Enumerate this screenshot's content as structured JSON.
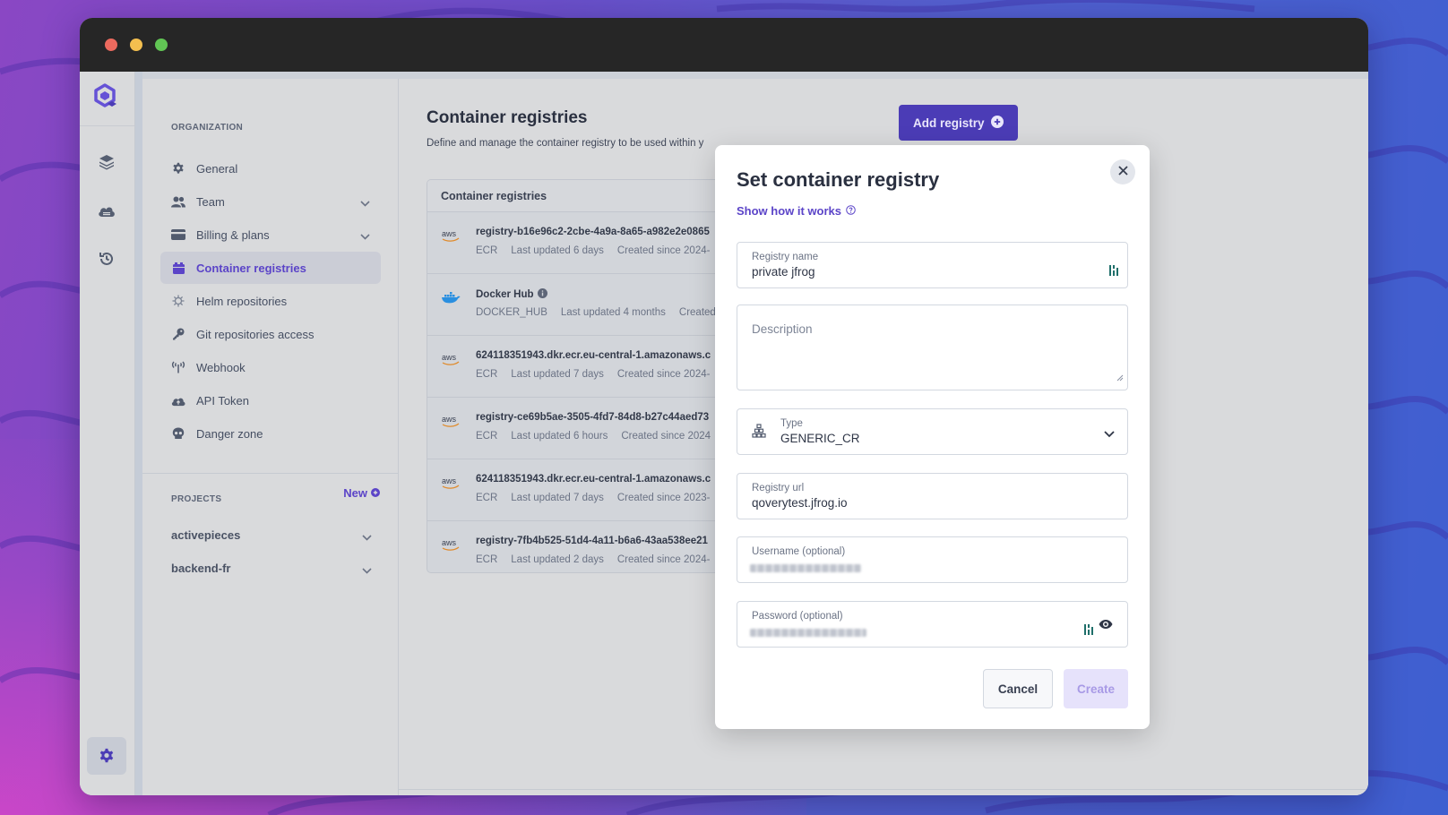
{
  "window": {
    "controls": [
      "close",
      "minimize",
      "maximize"
    ]
  },
  "rail": {
    "icons": [
      "logo-icon",
      "layers-icon",
      "cloud-icon",
      "history-icon",
      "settings-icon",
      "info-icon"
    ]
  },
  "sidebar": {
    "organization_label": "ORGANIZATION",
    "items": [
      {
        "label": "General",
        "icon": "gear-icon",
        "expandable": false
      },
      {
        "label": "Team",
        "icon": "users-icon",
        "expandable": true
      },
      {
        "label": "Billing & plans",
        "icon": "credit-card-icon",
        "expandable": true
      },
      {
        "label": "Container registries",
        "icon": "box-icon",
        "expandable": false,
        "active": true
      },
      {
        "label": "Helm repositories",
        "icon": "helm-icon",
        "expandable": false
      },
      {
        "label": "Git repositories access",
        "icon": "key-icon",
        "expandable": false
      },
      {
        "label": "Webhook",
        "icon": "antenna-icon",
        "expandable": false
      },
      {
        "label": "API Token",
        "icon": "cloud-upload-icon",
        "expandable": false
      },
      {
        "label": "Danger zone",
        "icon": "skull-icon",
        "expandable": false
      }
    ],
    "projects_label": "PROJECTS",
    "new_label": "New",
    "projects": [
      {
        "label": "activepieces"
      },
      {
        "label": "backend-fr"
      }
    ]
  },
  "main": {
    "title": "Container registries",
    "description": "Define and manage the container registry to be used within y",
    "add_button": "Add registry",
    "list_header": "Container registries",
    "registries": [
      {
        "provider": "aws",
        "name": "registry-b16e96c2-2cbe-4a9a-8a65-a982e2e0865",
        "kind": "ECR",
        "updated": "Last updated 6 days",
        "created": "Created since 2024-"
      },
      {
        "provider": "docker",
        "name": "Docker Hub",
        "kind": "DOCKER_HUB",
        "updated": "Last updated 4 months",
        "created": "Created",
        "info": true
      },
      {
        "provider": "aws",
        "name": "624118351943.dkr.ecr.eu-central-1.amazonaws.c",
        "kind": "ECR",
        "updated": "Last updated 7 days",
        "created": "Created since 2024-"
      },
      {
        "provider": "aws",
        "name": "registry-ce69b5ae-3505-4fd7-84d8-b27c44aed73",
        "kind": "ECR",
        "updated": "Last updated 6 hours",
        "created": "Created since 2024"
      },
      {
        "provider": "aws",
        "name": "624118351943.dkr.ecr.eu-central-1.amazonaws.c",
        "kind": "ECR",
        "updated": "Last updated 7 days",
        "created": "Created since 2023-"
      },
      {
        "provider": "aws",
        "name": "registry-7fb4b525-51d4-4a11-b6a6-43aa538ee21",
        "kind": "ECR",
        "updated": "Last updated 2 days",
        "created": "Created since 2024-"
      }
    ]
  },
  "modal": {
    "title": "Set container registry",
    "help_link": "Show how it works",
    "fields": {
      "registry_name": {
        "label": "Registry name",
        "value": "private jfrog"
      },
      "description": {
        "placeholder": "Description",
        "value": ""
      },
      "type": {
        "label": "Type",
        "value": "GENERIC_CR"
      },
      "registry_url": {
        "label": "Registry url",
        "value": "qoverytest.jfrog.io"
      },
      "username": {
        "label": "Username (optional)",
        "value": "[redacted]"
      },
      "password": {
        "label": "Password (optional)",
        "value": "[redacted]"
      }
    },
    "cancel_label": "Cancel",
    "create_label": "Create"
  },
  "colors": {
    "accent": "#5b44c8",
    "primary_button": "#4b3cb6",
    "disabled_button_bg": "#e6e2fb",
    "disabled_button_text": "#a89ae6",
    "traffic_red": "#ec6a5e",
    "traffic_yellow": "#f4bf4f",
    "traffic_green": "#61c554"
  }
}
